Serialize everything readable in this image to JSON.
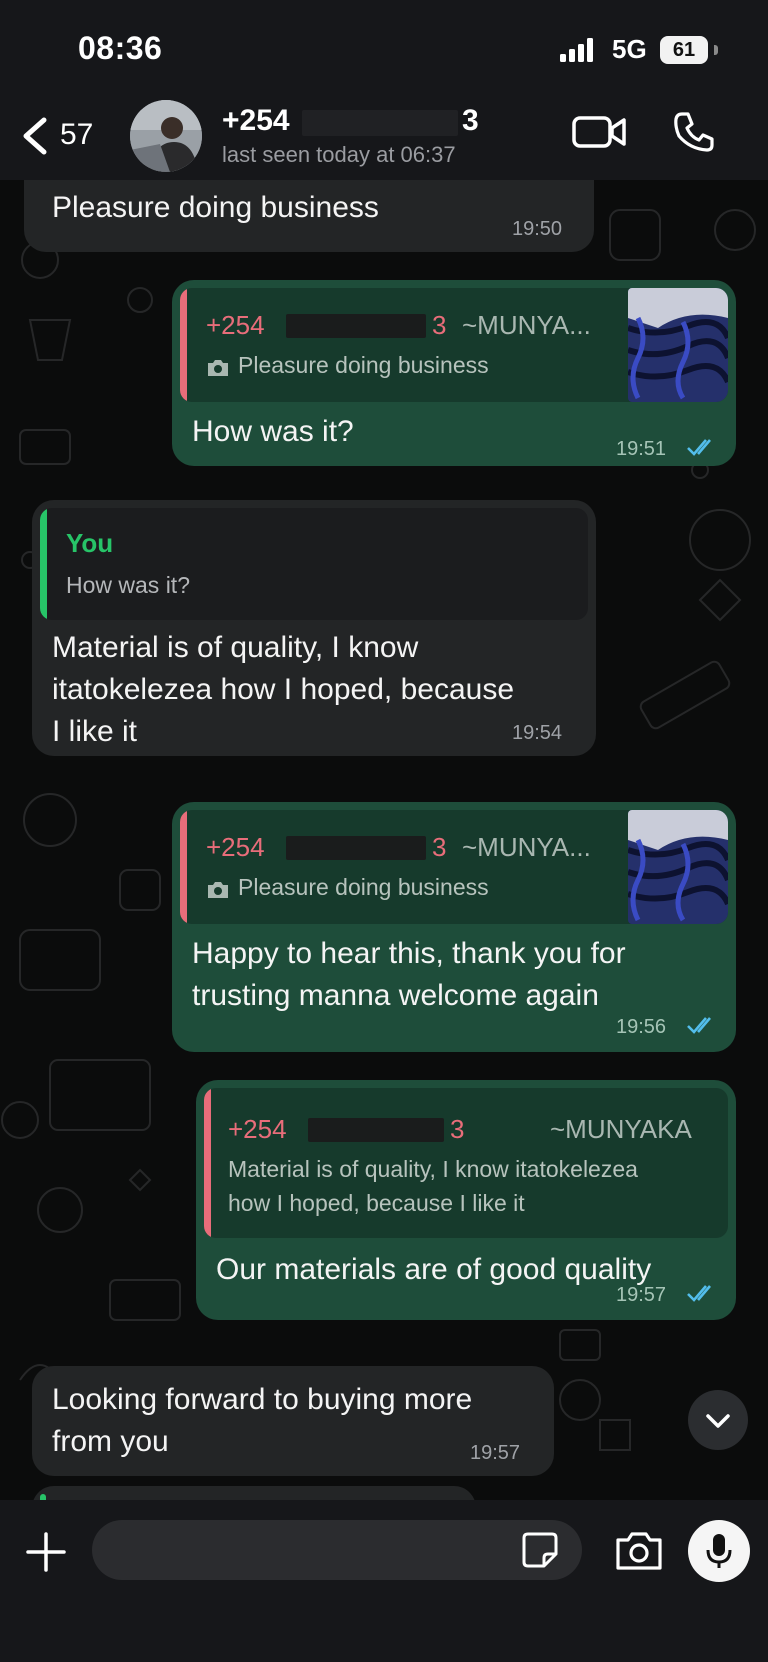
{
  "status_bar": {
    "time": "08:36",
    "network": "5G",
    "battery": "61"
  },
  "header": {
    "back_count": "57",
    "contact_prefix": "+254",
    "contact_suffix": "3",
    "last_seen": "last seen today at 06:37",
    "icons": [
      "back-chevron-icon",
      "video-call-icon",
      "phone-icon"
    ]
  },
  "messages": [
    {
      "direction": "in",
      "text": "Pleasure doing business",
      "time": "19:50"
    },
    {
      "direction": "out",
      "reply_to": {
        "name_prefix": "+254",
        "name_suffix": "3",
        "nickname": "~MUNYA...",
        "text": "Pleasure doing business",
        "has_photo": true
      },
      "text": "How was it?",
      "time": "19:51",
      "status": "read"
    },
    {
      "direction": "in",
      "reply_to": {
        "name": "You",
        "text": "How was it?"
      },
      "text_lines": [
        "Material is of quality, I know",
        "itatokelezea how I hoped, because",
        "I like it"
      ],
      "time": "19:54"
    },
    {
      "direction": "out",
      "reply_to": {
        "name_prefix": "+254",
        "name_suffix": "3",
        "nickname": "~MUNYA...",
        "text": "Pleasure doing business",
        "has_photo": true
      },
      "text_lines": [
        "Happy to hear this, thank you for",
        "trusting manna welcome again"
      ],
      "time": "19:56",
      "status": "read"
    },
    {
      "direction": "out",
      "reply_to": {
        "name_prefix": "+254",
        "name_suffix": "3",
        "nickname": "~MUNYAKA",
        "text_lines": [
          "Material is of quality, I know itatokelezea",
          "how I hoped, because I like it"
        ]
      },
      "text": "Our materials are of good quality",
      "time": "19:57",
      "status": "read"
    },
    {
      "direction": "in",
      "text_lines": [
        "Looking forward to buying more",
        "from you"
      ],
      "time": "19:57"
    }
  ],
  "composer": {
    "placeholder": "",
    "value": ""
  },
  "colors": {
    "outgoing_bubble": "#1e4d3a",
    "incoming_bubble": "#232526",
    "reply_name": "#e86d7a",
    "you_name": "#27c468",
    "read_ticks": "#53bdeb"
  }
}
